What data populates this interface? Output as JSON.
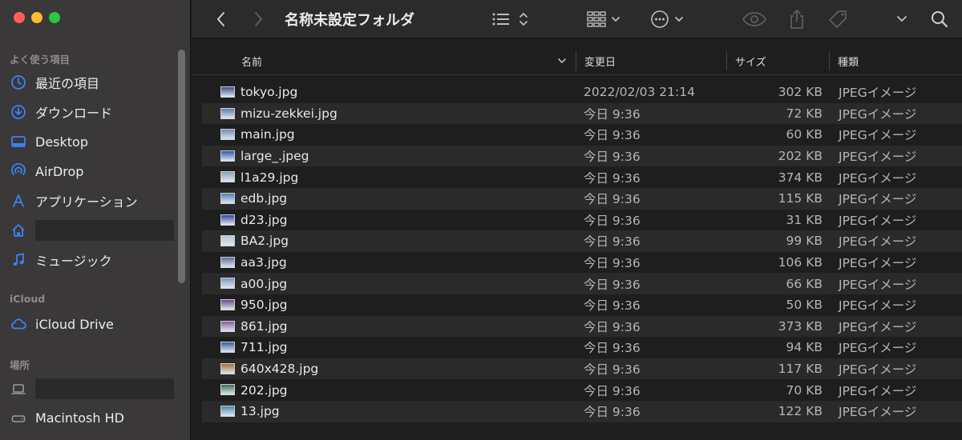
{
  "window": {
    "title": "名称未設定フォルダ"
  },
  "sidebar": {
    "favorites_heading": "よく使う項目",
    "favorites": [
      {
        "label": "最近の項目",
        "icon": "clock-icon"
      },
      {
        "label": "ダウンロード",
        "icon": "download-icon"
      },
      {
        "label": "Desktop",
        "icon": "desktop-icon"
      },
      {
        "label": "AirDrop",
        "icon": "airdrop-icon"
      },
      {
        "label": "アプリケーション",
        "icon": "applications-icon"
      },
      {
        "label": "",
        "icon": "home-icon"
      },
      {
        "label": "ミュージック",
        "icon": "music-icon"
      }
    ],
    "icloud_heading": "iCloud",
    "icloud": [
      {
        "label": "iCloud Drive",
        "icon": "cloud-icon"
      }
    ],
    "locations_heading": "場所",
    "locations": [
      {
        "label": "",
        "icon": "laptop-icon"
      },
      {
        "label": "Macintosh HD",
        "icon": "disk-icon"
      }
    ]
  },
  "columns": {
    "name": "名前",
    "date": "変更日",
    "size": "サイズ",
    "kind": "種類"
  },
  "files": [
    {
      "name": "tokyo.jpg",
      "date": "2022/02/03 21:14",
      "size": "302 KB",
      "kind": "JPEGイメージ",
      "thumb": "#3c4f8a"
    },
    {
      "name": "mizu-zekkei.jpg",
      "date": "今日 9:36",
      "size": "72 KB",
      "kind": "JPEGイメージ",
      "thumb": "#5a7fa8"
    },
    {
      "name": "main.jpg",
      "date": "今日 9:36",
      "size": "60 KB",
      "kind": "JPEGイメージ",
      "thumb": "#6b8fb5"
    },
    {
      "name": "large_.jpeg",
      "date": "今日 9:36",
      "size": "202 KB",
      "kind": "JPEGイメージ",
      "thumb": "#2e56a8"
    },
    {
      "name": "l1a29.jpg",
      "date": "今日 9:36",
      "size": "374 KB",
      "kind": "JPEGイメージ",
      "thumb": "#8ca0b8"
    },
    {
      "name": "edb.jpg",
      "date": "今日 9:36",
      "size": "115 KB",
      "kind": "JPEGイメージ",
      "thumb": "#4e7fb8"
    },
    {
      "name": "d23.jpg",
      "date": "今日 9:36",
      "size": "31 KB",
      "kind": "JPEGイメージ",
      "thumb": "#2c4a9a"
    },
    {
      "name": "BA2.jpg",
      "date": "今日 9:36",
      "size": "99 KB",
      "kind": "JPEGイメージ",
      "thumb": "#b8c4d6"
    },
    {
      "name": "aa3.jpg",
      "date": "今日 9:36",
      "size": "106 KB",
      "kind": "JPEGイメージ",
      "thumb": "#5c6e9e"
    },
    {
      "name": "a00.jpg",
      "date": "今日 9:36",
      "size": "66 KB",
      "kind": "JPEGイメージ",
      "thumb": "#7a9ac0"
    },
    {
      "name": "950.jpg",
      "date": "今日 9:36",
      "size": "50 KB",
      "kind": "JPEGイメージ",
      "thumb": "#6a4a8a"
    },
    {
      "name": "861.jpg",
      "date": "今日 9:36",
      "size": "373 KB",
      "kind": "JPEGイメージ",
      "thumb": "#8a5a9a"
    },
    {
      "name": "711.jpg",
      "date": "今日 9:36",
      "size": "94 KB",
      "kind": "JPEGイメージ",
      "thumb": "#3a5e9e"
    },
    {
      "name": "640x428.jpg",
      "date": "今日 9:36",
      "size": "117 KB",
      "kind": "JPEGイメージ",
      "thumb": "#a0703a"
    },
    {
      "name": "202.jpg",
      "date": "今日 9:36",
      "size": "70 KB",
      "kind": "JPEGイメージ",
      "thumb": "#3a6e5a"
    },
    {
      "name": "13.jpg",
      "date": "今日 9:36",
      "size": "122 KB",
      "kind": "JPEGイメージ",
      "thumb": "#4a8ab0"
    }
  ],
  "colors": {
    "accent": "#3b82f6",
    "sidebar_bg": "#3a3838",
    "window_bg": "#1e1e1e",
    "row_alt": "#2a2a2a"
  }
}
